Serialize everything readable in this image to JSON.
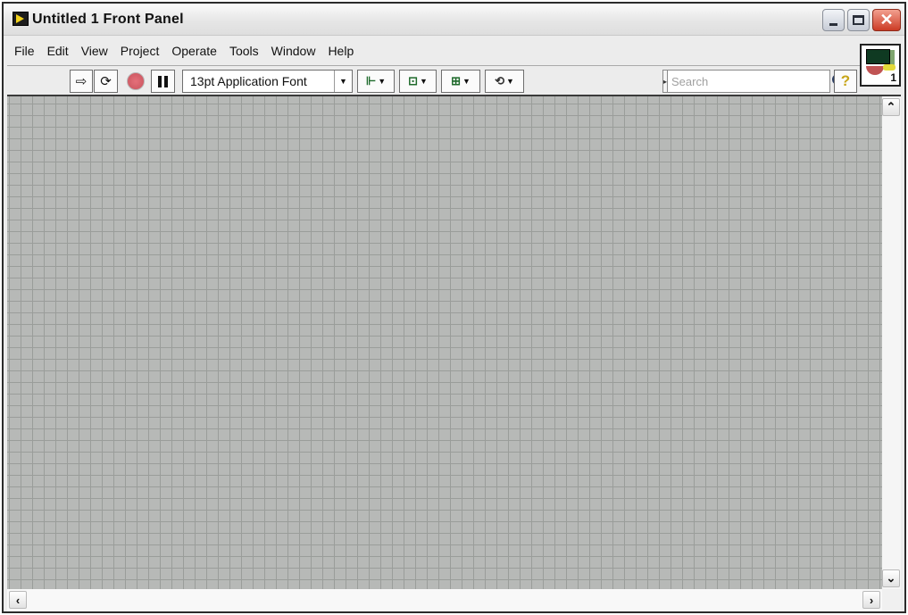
{
  "window": {
    "title": "Untitled 1 Front Panel",
    "app_icon": "labview-run-arrow-icon",
    "controls": {
      "minimize": "minimize-icon",
      "maximize": "maximize-icon",
      "close": "✕"
    }
  },
  "menubar": {
    "items": [
      {
        "label": "File"
      },
      {
        "label": "Edit"
      },
      {
        "label": "View"
      },
      {
        "label": "Project"
      },
      {
        "label": "Operate"
      },
      {
        "label": "Tools"
      },
      {
        "label": "Window"
      },
      {
        "label": "Help"
      }
    ]
  },
  "toolbar": {
    "run_icon": "⇨",
    "run_continuously_icon": "⟳",
    "abort_icon": "stop-circle-icon",
    "pause_icon": "pause-icon",
    "font_select": {
      "value": "13pt Application Font",
      "arrow": "▼"
    },
    "align_icon": "⊩",
    "distribute_icon": "⊡",
    "resize_icon": "⊞",
    "reorder_icon": "⟲",
    "dropdown_arrow": "▼",
    "search": {
      "toggle": "▸",
      "placeholder": "Search",
      "value": ""
    },
    "help_icon": "?"
  },
  "vi_icon": {
    "number": "1"
  },
  "scrollbars": {
    "up": "⌃",
    "down": "⌄",
    "left": "‹",
    "right": "›"
  },
  "colors": {
    "canvas_bg": "#b7b9b7",
    "grid_line": "#9a9d9a",
    "close_button": "#cc3b25"
  }
}
